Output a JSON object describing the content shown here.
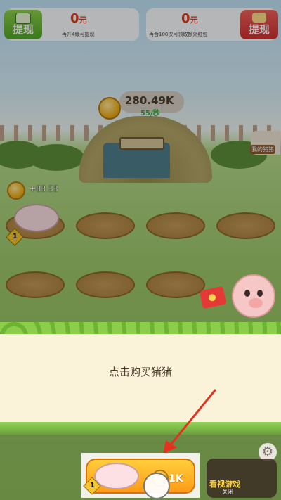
{
  "hud": {
    "left": {
      "button_label": "提现",
      "amount": "0",
      "unit": "元",
      "note": "再升4级可提现"
    },
    "right": {
      "button_label": "提现",
      "amount": "0",
      "unit": "元",
      "note": "再合100次可领取额外红包"
    }
  },
  "farm": {
    "rate_value": "280.49K",
    "rate_per_sec": "55/秒",
    "income_popup": "+83.33",
    "my_pigs_label": "我的猪猪",
    "pig_level": "1"
  },
  "panel": {
    "hint": "点击购买猪猪"
  },
  "bottom": {
    "buy_price": "1K",
    "buy_level": "1",
    "game_title": "游戏",
    "game_title_prefix": "看视",
    "game_sub": "关闭"
  },
  "colors": {
    "accent_orange": "#ff9a16",
    "accent_green": "#4fa827",
    "accent_red": "#d22f2f",
    "arrow_red": "#e5321e"
  },
  "icons": [
    "wallet-icon",
    "red-envelope-icon",
    "coin-icon",
    "gear-icon",
    "hand-pointer-icon",
    "arrow-icon"
  ]
}
